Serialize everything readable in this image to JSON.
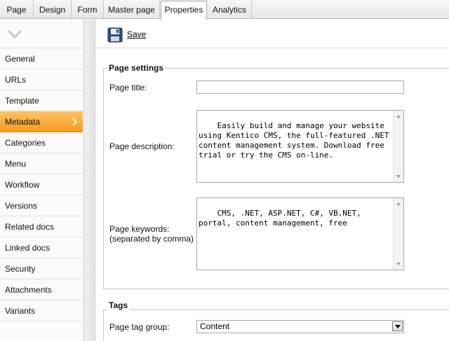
{
  "tabs": [
    {
      "label": "Page",
      "active": false
    },
    {
      "label": "Design",
      "active": false
    },
    {
      "label": "Form",
      "active": false
    },
    {
      "label": "Master page",
      "active": false
    },
    {
      "label": "Properties",
      "active": true
    },
    {
      "label": "Analytics",
      "active": false
    }
  ],
  "sidebar": {
    "items": [
      {
        "label": "General"
      },
      {
        "label": "URLs"
      },
      {
        "label": "Template"
      },
      {
        "label": "Metadata",
        "active": true
      },
      {
        "label": "Categories"
      },
      {
        "label": "Menu"
      },
      {
        "label": "Workflow"
      },
      {
        "label": "Versions"
      },
      {
        "label": "Related docs"
      },
      {
        "label": "Linked docs"
      },
      {
        "label": "Security"
      },
      {
        "label": "Attachments"
      },
      {
        "label": "Variants"
      }
    ]
  },
  "toolbar": {
    "save_label": "Save"
  },
  "page_settings": {
    "legend": "Page settings",
    "title_label": "Page title:",
    "title_value": "",
    "description_label": "Page description:",
    "description_value": "Easily build and manage your website using Kentico CMS, the full-featured .NET content management system. Download free trial or try the CMS on-line.",
    "keywords_label_line1": "Page keywords:",
    "keywords_label_line2": "(separated by comma)",
    "keywords_value": "CMS, .NET, ASP.NET, C#, VB.NET, portal, content management, free"
  },
  "tags": {
    "legend": "Tags",
    "group_label": "Page tag group:",
    "group_value": "Content"
  },
  "colors": {
    "accent": "#f39a20",
    "accent_light": "#ffc563"
  }
}
